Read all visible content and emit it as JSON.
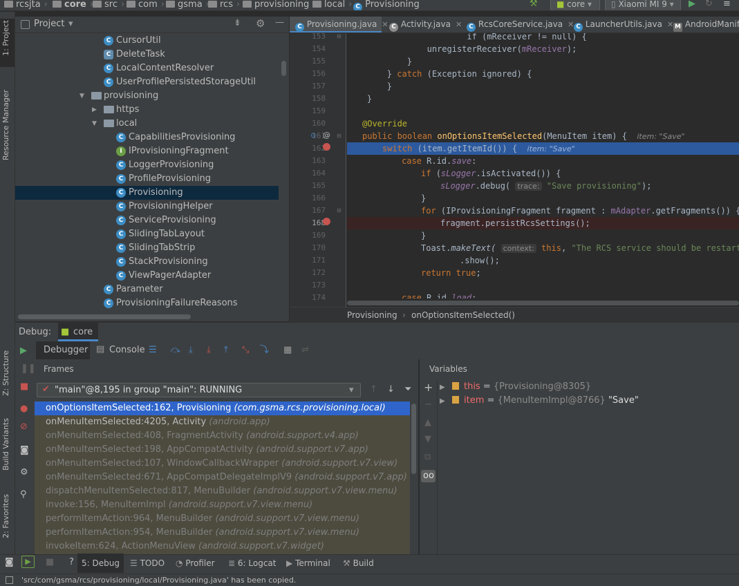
{
  "colors": {
    "panel": "#3c3f41",
    "editor_bg": "#2b2b2b",
    "selection": "#2f65ca",
    "exec_line": "#2d5a9f",
    "keyword": "#cc7832",
    "method": "#ffc66d",
    "string": "#6a8759",
    "annotation": "#bbb529",
    "field": "#9876aa"
  },
  "navbar": {
    "crumbs": [
      "rcsjta",
      "core",
      "src",
      "com",
      "gsma",
      "rcs",
      "provisioning",
      "local",
      "Provisioning"
    ],
    "run_config": "core",
    "device": "Xiaomi MI 9"
  },
  "left_strip": {
    "project": "1: Project",
    "resource_manager": "Resource Manager",
    "structure": "Z: Structure",
    "build_variants": "Build Variants",
    "favorites": "2: Favorites"
  },
  "project_panel": {
    "title": "Project",
    "items": [
      {
        "label": "CursorUtil",
        "icon": "class"
      },
      {
        "label": "DeleteTask",
        "icon": "abstract-class"
      },
      {
        "label": "LocalContentResolver",
        "icon": "class"
      },
      {
        "label": "UserProfilePersistedStorageUtil",
        "icon": "class"
      },
      {
        "label": "provisioning",
        "icon": "folder",
        "arrow": "expanded"
      },
      {
        "label": "https",
        "icon": "folder",
        "arrow": "collapsed"
      },
      {
        "label": "local",
        "icon": "folder",
        "arrow": "expanded"
      },
      {
        "label": "CapabilitiesProvisioning",
        "icon": "class"
      },
      {
        "label": "IProvisioningFragment",
        "icon": "interface"
      },
      {
        "label": "LoggerProvisioning",
        "icon": "class"
      },
      {
        "label": "ProfileProvisioning",
        "icon": "class"
      },
      {
        "label": "Provisioning",
        "icon": "class",
        "selected": true
      },
      {
        "label": "ProvisioningHelper",
        "icon": "class"
      },
      {
        "label": "ServiceProvisioning",
        "icon": "class"
      },
      {
        "label": "SlidingTabLayout",
        "icon": "class"
      },
      {
        "label": "SlidingTabStrip",
        "icon": "class"
      },
      {
        "label": "StackProvisioning",
        "icon": "class"
      },
      {
        "label": "ViewPagerAdapter",
        "icon": "class"
      },
      {
        "label": "Parameter",
        "icon": "class"
      },
      {
        "label": "ProvisioningFailureReasons",
        "icon": "class"
      }
    ]
  },
  "editor": {
    "tabs": [
      {
        "label": "Provisioning.java",
        "active": true
      },
      {
        "label": "Activity.java"
      },
      {
        "label": "RcsCoreService.java"
      },
      {
        "label": "LauncherUtils.java"
      },
      {
        "label": "AndroidManife"
      }
    ],
    "line_numbers": [
      "153",
      "154",
      "155",
      "156",
      "157",
      "158",
      "159",
      "160",
      "161",
      "162",
      "163",
      "164",
      "165",
      "166",
      "167",
      "168",
      "169",
      "170",
      "171",
      "172",
      "173",
      "174"
    ],
    "code": {
      "l153": "            if (mReceiver != null) {",
      "l154_a": "                unregisterReceiver(",
      "l154_b": "mReceiver",
      "l154_c": ");",
      "l155": "            }",
      "l156_a": "        } ",
      "l156_b": "catch",
      "l156_c": " (Exception ignored) {",
      "l157": "        }",
      "l158": "    }",
      "l160": "@Override",
      "l161_a": "public boolean ",
      "l161_b": "onOptionsItemSelected",
      "l161_c": "(MenuItem item) {",
      "l161_hint": "item: \"Save\"",
      "l162_a": "switch",
      "l162_b": " (item.getItemId()) {",
      "l162_hint": "item: \"Save\"",
      "l163_a": "case ",
      "l163_b": "R.id.",
      "l163_c": "save",
      "l163_d": ":",
      "l164_a": "if ",
      "l164_b": "(",
      "l164_c": "sLogger",
      "l164_d": ".isActivated()) {",
      "l165_a": "sLogger",
      "l165_b": ".debug(",
      "l165_hint": "trace:",
      "l165_str": "\"Save provisioning\"",
      "l165_c": ");",
      "l166": "}",
      "l167_a": "for ",
      "l167_b": "(IProvisioningFragment fragment : ",
      "l167_c": "mAdapter",
      "l167_d": ".getFragments()) {",
      "l168": "fragment.persistRcsSettings();",
      "l169": "}",
      "l170_a": "Toast.",
      "l170_b": "makeText(",
      "l170_hint": "context:",
      "l170_c": "this",
      "l170_d": ", ",
      "l170_str": "\"The RCS service should be restarted",
      "l171": ".show();",
      "l172_a": "return ",
      "l172_b": "true",
      "l172_c": ";",
      "l174_a": "case ",
      "l174_b": "R.id.",
      "l174_c": "load",
      "l174_d": ":"
    },
    "breadcrumb": [
      "Provisioning",
      "onOptionsItemSelected()"
    ]
  },
  "debug": {
    "label": "Debug:",
    "session": "core",
    "tabs": {
      "debugger": "Debugger",
      "console": "Console"
    },
    "frames_title": "Frames",
    "thread": "\"main\"@8,195 in group \"main\": RUNNING",
    "frames": [
      {
        "method": "onOptionsItemSelected:162, Provisioning",
        "pkg": "(com.gsma.rcs.provisioning.local)",
        "selected": true
      },
      {
        "method": "onMenuItemSelected:4205, Activity",
        "pkg": "(android.app)",
        "user": true
      },
      {
        "method": "onMenuItemSelected:408, FragmentActivity",
        "pkg": "(android.support.v4.app)"
      },
      {
        "method": "onMenuItemSelected:198, AppCompatActivity",
        "pkg": "(android.support.v7.app)"
      },
      {
        "method": "onMenuItemSelected:107, WindowCallbackWrapper",
        "pkg": "(android.support.v7.view)"
      },
      {
        "method": "onMenuItemSelected:671, AppCompatDelegateImplV9",
        "pkg": "(android.support.v7.app)"
      },
      {
        "method": "dispatchMenuItemSelected:817, MenuBuilder",
        "pkg": "(android.support.v7.view.menu)"
      },
      {
        "method": "invoke:156, MenuItemImpl",
        "pkg": "(android.support.v7.view.menu)"
      },
      {
        "method": "performItemAction:964, MenuBuilder",
        "pkg": "(android.support.v7.view.menu)"
      },
      {
        "method": "performItemAction:954, MenuBuilder",
        "pkg": "(android.support.v7.view.menu)"
      },
      {
        "method": "invokeItem:624, ActionMenuView",
        "pkg": "(android.support.v7.widget)"
      }
    ],
    "variables_title": "Variables",
    "variables": [
      {
        "name": "this",
        "eq": " = ",
        "value": "{Provisioning@8305}",
        "extra": ""
      },
      {
        "name": "item",
        "eq": " = ",
        "value": "{MenuItemImpl@8766}",
        "extra": " \"Save\""
      }
    ]
  },
  "bottom_tabs": [
    {
      "label": "5: Debug",
      "active": true
    },
    {
      "label": "TODO"
    },
    {
      "label": "Profiler"
    },
    {
      "label": "6: Logcat"
    },
    {
      "label": "Terminal"
    },
    {
      "label": "Build"
    }
  ],
  "status_message": "'src/com/gsma/rcs/provisioning/local/Provisioning.java' has been copied."
}
